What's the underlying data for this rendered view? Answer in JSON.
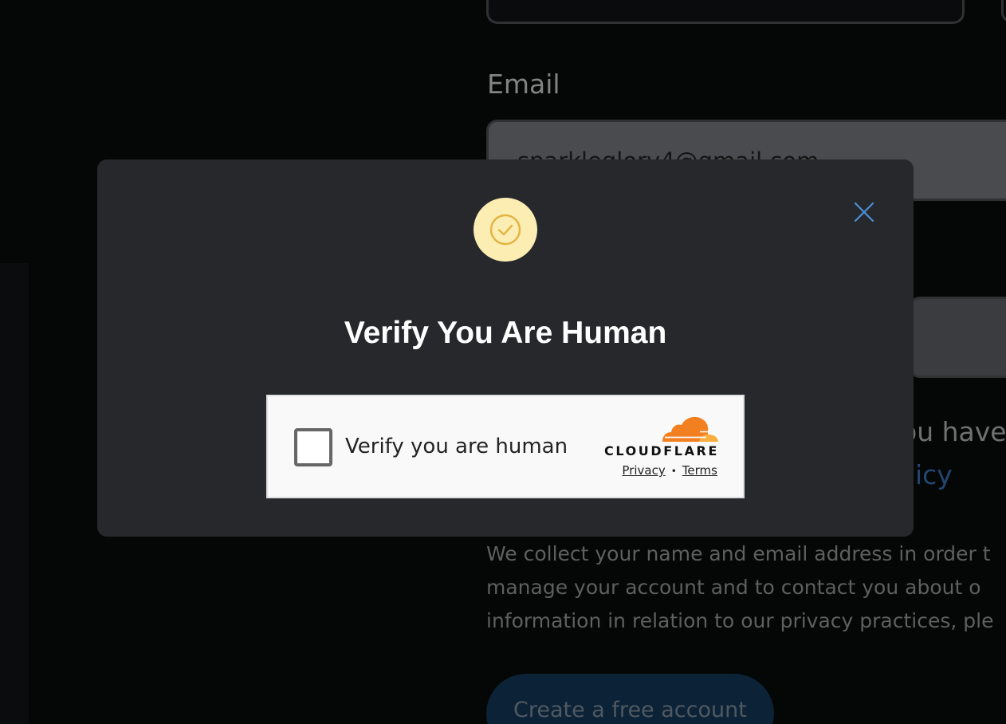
{
  "background_form": {
    "email_label": "Email",
    "email_value": "sparkleglory4@gmail.com",
    "agree_text_fragment": "ou have",
    "agree_link_fragment": "icy",
    "info_lines": [
      "We collect your name and email address in order t",
      "manage your account and to contact you about o",
      "information in relation to our privacy practices, ple"
    ],
    "create_account_label": "Create a free account"
  },
  "modal": {
    "badge_icon": "check-circle-icon",
    "close_icon": "close-icon",
    "title": "Verify You Are Human",
    "colors": {
      "background": "#26282c",
      "badge": "#fcedb2",
      "badge_icon": "#e3b341",
      "close": "#4a90d9"
    }
  },
  "turnstile": {
    "checkbox_label": "Verify you are human",
    "brand": "CLOUDFLARE",
    "privacy_label": "Privacy",
    "separator": "•",
    "terms_label": "Terms",
    "colors": {
      "cloud_orange": "#f38020",
      "cloud_light": "#faae40"
    }
  }
}
